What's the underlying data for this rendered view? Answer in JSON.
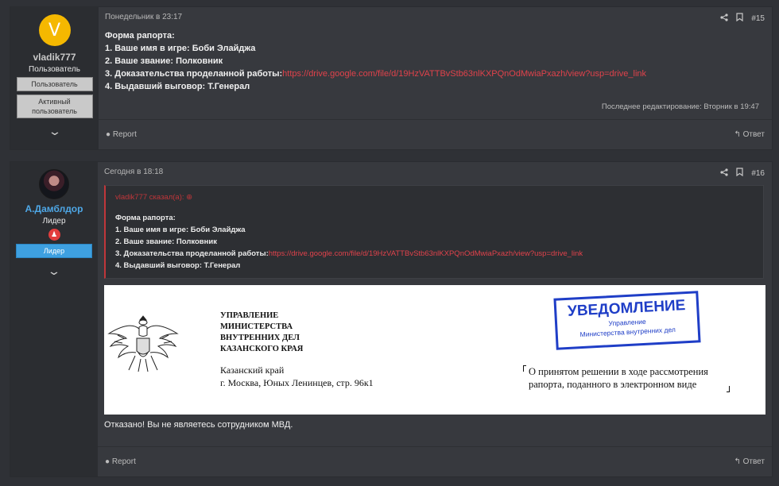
{
  "posts": [
    {
      "user": {
        "avatar_letter": "V",
        "name": "vladik777",
        "title": "Пользователь",
        "badges": [
          "Пользователь",
          "Активный пользователь"
        ]
      },
      "date": "Понедельник в 23:17",
      "number": "#15",
      "lines": [
        "Форма рапорта:",
        "1. Ваше имя в игре: Боби Элайджа",
        "2. Ваше звание: Полковник",
        "3. Доказательства проделанной работы:",
        "4. Выдавший выговор: Т.Генерал"
      ],
      "link": "https://drive.google.com/file/d/19HzVATTBvStb63nlKXPQnOdMwiaPxazh/view?usp=drive_link",
      "edited": "Последнее редактирование: Вторник в 19:47",
      "report": "Report",
      "reply": "Ответ"
    },
    {
      "user": {
        "name": "А.Дамблдор",
        "title": "Лидер",
        "badges": [
          "Лидер"
        ]
      },
      "date": "Сегодня в 18:18",
      "number": "#16",
      "quote": {
        "author": "vladik777 сказал(а):",
        "lines": [
          "Форма рапорта:",
          "1. Ваше имя в игре: Боби Элайджа",
          "2. Ваше звание: Полковник",
          "3. Доказательства проделанной работы:",
          "4. Выдавший выговор: Т.Генерал"
        ],
        "link": "https://drive.google.com/file/d/19HzVATTBvStb63nlKXPQnOdMwiaPxazh/view?usp=drive_link"
      },
      "document": {
        "org_lines": [
          "УПРАВЛЕНИЕ",
          "МИНИСТЕРСТВА",
          "ВНУТРЕННИХ ДЕЛ",
          "КАЗАНСКОГО КРАЯ"
        ],
        "address_lines": [
          "Казанский край",
          "г. Москва, Юных Ленинцев, стр. 96к1"
        ],
        "stamp_title": "УВЕДОМЛЕНИЕ",
        "stamp_sub": [
          "Управление",
          "Министерства внутренних дел"
        ],
        "decision_lines": [
          "О принятом решении в ходе рассмотрения",
          "рапорта, поданного в электронном виде"
        ]
      },
      "text": "Отказано! Вы не являетесь сотрудником МВД.",
      "report": "Report",
      "reply": "Ответ"
    }
  ],
  "icons": {
    "share": "share-icon",
    "bookmark": "bookmark-icon",
    "flag": "flag-icon",
    "reply": "reply-icon",
    "expand": "chevron-down-icon"
  }
}
